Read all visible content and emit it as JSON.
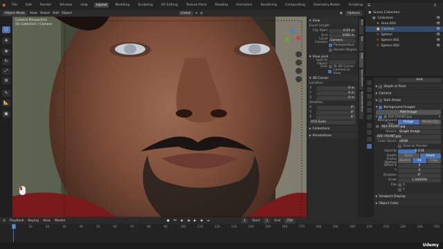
{
  "menu": {
    "items": [
      "File",
      "Edit",
      "Render",
      "Window",
      "Help"
    ],
    "workspaces": [
      "Layout",
      "Modeling",
      "Sculpting",
      "UV Editing",
      "Texture Paint",
      "Shading",
      "Animation",
      "Rendering",
      "Compositing",
      "Geometry Nodes",
      "Scripting"
    ],
    "active_workspace": "Layout",
    "scene": "Scene",
    "view_layer": "ViewLayer"
  },
  "viewport_header": {
    "mode": "Object Mode",
    "menus": [
      "View",
      "Select",
      "Add",
      "Object"
    ],
    "transform": "Global",
    "options": "Options"
  },
  "viewport": {
    "camera_title": "Camera Perspective",
    "collection_label": "(0) Collection | Camera"
  },
  "npanel": {
    "view_header": "View",
    "focal_label": "Focal Length",
    "clip_start_label": "Clip Start",
    "clip_start": "0.01 m",
    "end_label": "End",
    "end": "1000 m",
    "local_camera_label": "Local Camera",
    "local_camera": "Camera",
    "passepartout": "Passepartout",
    "render_region": "Render Region",
    "view_lock_header": "View Lock",
    "lock_to_object": "Lock to Object",
    "lock_label": "Lock",
    "to_3d_cursor": "To 3D Cursor",
    "camera_to_view": "Camera to View",
    "cursor_header": "3D Cursor",
    "location_label": "Location:",
    "x": "X",
    "y": "Y",
    "z": "Z",
    "loc_value": "0 m",
    "rotation_label": "Rotation:",
    "rot_value": "0°",
    "xyz_euler": "XYZ Euler",
    "collections": "Collections",
    "annotations": "Annotations",
    "side_tabs": [
      "Item",
      "Tool",
      "View",
      "Quick Wrench",
      "Screencast Keys"
    ]
  },
  "outliner": {
    "title": "Scene Collection",
    "items": [
      {
        "name": "Collection",
        "icon": "collection-icon"
      },
      {
        "name": "Area.003",
        "icon": "light-icon"
      },
      {
        "name": "Camera",
        "icon": "camera-icon"
      },
      {
        "name": "Sphere",
        "icon": "mesh-icon"
      },
      {
        "name": "Sphere.001",
        "icon": "mesh-icon"
      },
      {
        "name": "Sphere.002",
        "icon": "mesh-icon"
      }
    ]
  },
  "properties": {
    "unit_value": "Unit",
    "dof": "Depth of Field",
    "camera_sec": "Camera",
    "safe_areas": "Safe Areas",
    "background_images": "Background Images",
    "add_image": "Add Image",
    "image_ref": "REF-FRONT.jpg",
    "bg_source_label": "Background Sou...",
    "image_btn": "Image",
    "movie_clip_btn": "Movie Clip",
    "image_name": "REF-FRONT.jpg",
    "source_label": "Source",
    "source_value": "Single Image",
    "image_file": "REF-FRONT.jpg",
    "color_space_label": "Color Space",
    "color_space": "sRGB",
    "view_as_render": "View as Render",
    "opacity_label": "Opacity",
    "opacity": "0.418",
    "depth_label": "Depth",
    "depth_back": "Back",
    "depth_front": "Front",
    "frame_method_label": "Frame Method",
    "fm_stretch": "Stretch",
    "fm_fit": "Fit",
    "fm_crop": "Crop",
    "offset_x_label": "Offset X",
    "offset_x": "0",
    "y_label": "Y",
    "offset_y": "0",
    "rotation_label": "Rotation",
    "rotation": "0°",
    "scale_label": "Scale",
    "scale": "1.000000",
    "flip_label": "Flip",
    "flip_x": "X",
    "flip_y": "Y",
    "viewport_display": "Viewport Display",
    "object_color": "Object Color"
  },
  "timeline": {
    "menus": [
      "Playback",
      "Keying",
      "View",
      "Marker"
    ],
    "current_frame": "1",
    "start_label": "Start",
    "start": "1",
    "end_label": "End",
    "end": "250",
    "ticks": [
      "0",
      "10",
      "20",
      "30",
      "40",
      "50",
      "60",
      "70",
      "80",
      "90",
      "100",
      "110",
      "120",
      "130",
      "140",
      "150",
      "160",
      "170",
      "180",
      "190",
      "200",
      "210",
      "220",
      "230",
      "240",
      "250"
    ]
  },
  "watermark": "Udemy"
}
